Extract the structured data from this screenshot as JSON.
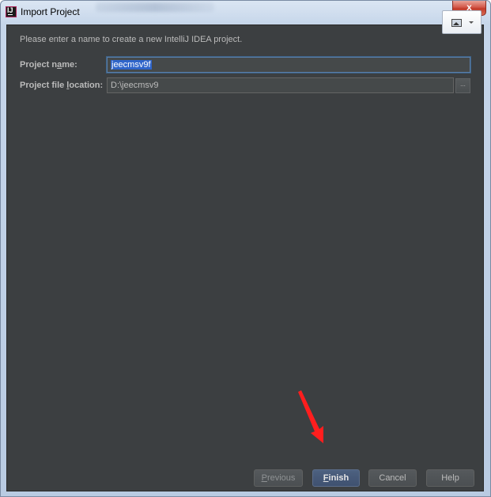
{
  "window": {
    "title": "Import Project",
    "close_glyph": "x"
  },
  "dialog": {
    "intro": "Please enter a name to create a new IntelliJ IDEA project.",
    "project_name": {
      "label_pre": "Project n",
      "label_mnemonic": "a",
      "label_post": "me:",
      "value": "jeecmsv9f"
    },
    "project_location": {
      "label_pre": "Project file ",
      "label_mnemonic": "l",
      "label_post": "ocation:",
      "value": "D:\\jeecmsv9",
      "browse_label": "..."
    }
  },
  "buttons": {
    "previous": {
      "mnemonic": "P",
      "rest": "revious"
    },
    "finish": {
      "mnemonic": "F",
      "rest": "inish"
    },
    "cancel": "Cancel",
    "help": "Help"
  },
  "colors": {
    "dialog_bg": "#3c3f41",
    "text": "#bbbbbb",
    "selection": "#2f65ca",
    "annotation_arrow": "#ff1e1e"
  },
  "icons": {
    "app": "intellij-idea-icon",
    "snip": "screenshot-tool-icon",
    "close": "close-icon"
  }
}
